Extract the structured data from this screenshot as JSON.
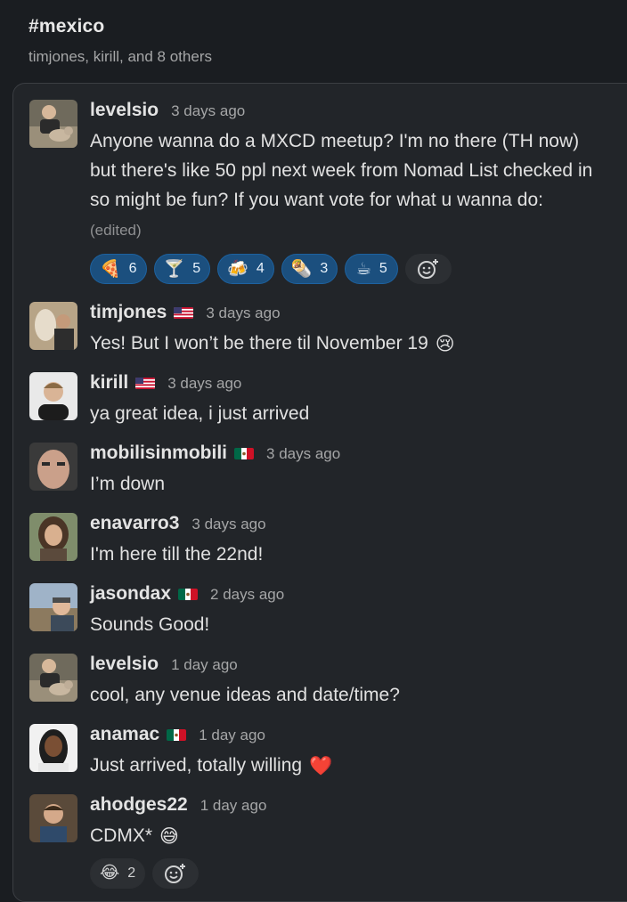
{
  "channel": {
    "name": "#mexico",
    "members": "timjones, kirill, and 8 others"
  },
  "messages": [
    {
      "user": "levelsio",
      "flag": "",
      "time": "3 days ago",
      "text": "Anyone wanna do a MXCD meetup? I'm no there (TH now) but there's like 50 ppl next week from Nomad List checked in so might be fun? If you want vote for what u wanna do:",
      "edited": "(edited)",
      "reactions": [
        {
          "emoji": "🍕",
          "count": "6"
        },
        {
          "emoji": "🍸",
          "count": "5"
        },
        {
          "emoji": "🍻",
          "count": "4"
        },
        {
          "emoji": "🌯",
          "count": "3"
        },
        {
          "emoji": "☕",
          "count": "5"
        }
      ]
    },
    {
      "user": "timjones",
      "flag": "us",
      "time": "3 days ago",
      "text": "Yes! But I won’t be there til November 19",
      "emoji": "😢"
    },
    {
      "user": "kirill",
      "flag": "us",
      "time": "3 days ago",
      "text": "ya great idea, i just arrived"
    },
    {
      "user": "mobilisinmobili",
      "flag": "mx",
      "time": "3 days ago",
      "text": "I’m down"
    },
    {
      "user": "enavarro3",
      "flag": "",
      "time": "3 days ago",
      "text": "I'm here till the 22nd!"
    },
    {
      "user": "jasondax",
      "flag": "mx",
      "time": "2 days ago",
      "text": "Sounds Good!"
    },
    {
      "user": "levelsio",
      "flag": "",
      "time": "1 day ago",
      "text": "cool, any venue ideas and date/time?"
    },
    {
      "user": "anamac",
      "flag": "mx",
      "time": "1 day ago",
      "text": "Just arrived, totally willing",
      "emoji": "❤️"
    },
    {
      "user": "ahodges22",
      "flag": "",
      "time": "1 day ago",
      "text": "CDMX*",
      "emoji": "😅",
      "reactions": [
        {
          "emoji": "😂",
          "count": "2"
        }
      ]
    }
  ],
  "colors": {
    "background": "#1a1d21",
    "panel": "#222529",
    "reaction_active": "#1b4f7e",
    "reaction_border": "#1d62a0"
  }
}
